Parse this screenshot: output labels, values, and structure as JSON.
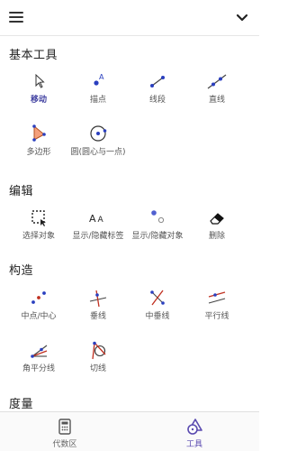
{
  "sections": {
    "basic": {
      "title": "基本工具",
      "tools": [
        "移动",
        "描点",
        "线段",
        "直线",
        "多边形",
        "圆(圆心与一点)"
      ]
    },
    "edit": {
      "title": "编辑",
      "tools": [
        "选择对象",
        "显示/隐藏标签",
        "显示/隐藏对象",
        "删除"
      ]
    },
    "construct": {
      "title": "构造",
      "tools": [
        "中点/中心",
        "垂线",
        "中垂线",
        "平行线",
        "角平分线",
        "切线"
      ]
    },
    "measure": {
      "title": "度量"
    }
  },
  "bottom_tabs": [
    "代数区",
    "工具"
  ],
  "active_tab": "工具",
  "selected_tool": "移动",
  "colors": {
    "accent": "#3f3fa0",
    "point": "#2a3fbf",
    "shape": "#e06030",
    "tab_active": "#5a4ab0"
  }
}
